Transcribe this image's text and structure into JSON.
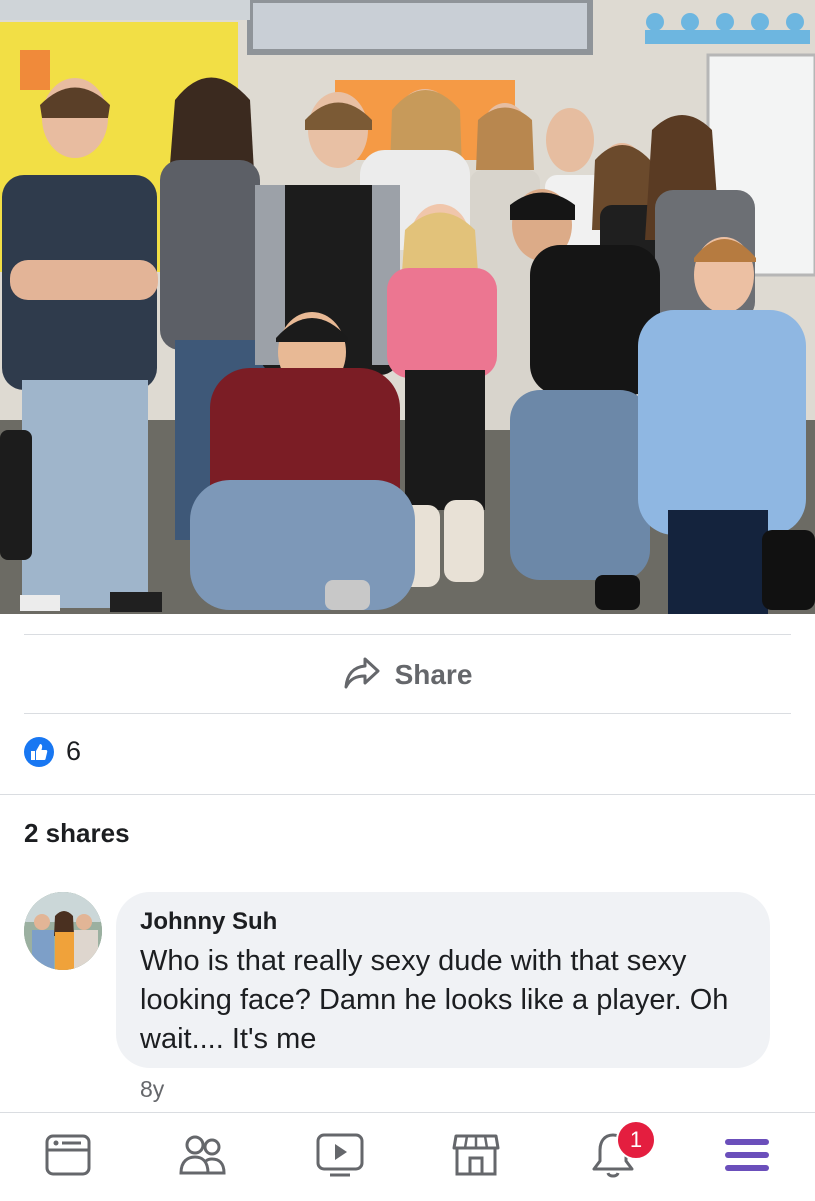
{
  "post": {
    "photo_alt": "Group photo of students in a classroom",
    "actions": {
      "share_label": "Share"
    },
    "reactions": {
      "like_count": "6"
    },
    "shares_label": "2 shares"
  },
  "comment": {
    "author": "Johnny Suh",
    "text": "Who is that really sexy dude with that sexy looking face? Damn he looks like a player. Oh wait.... It's me",
    "time": "8y"
  },
  "nav": {
    "items": [
      {
        "icon": "news-feed-icon"
      },
      {
        "icon": "friends-icon"
      },
      {
        "icon": "watch-icon"
      },
      {
        "icon": "marketplace-icon"
      },
      {
        "icon": "notifications-icon"
      },
      {
        "icon": "menu-icon"
      }
    ],
    "notification_badge": "1"
  },
  "colors": {
    "accent": "#1877f2",
    "badge": "#e41e3f",
    "menu": "#6b4fbb",
    "icon": "#65676b"
  }
}
